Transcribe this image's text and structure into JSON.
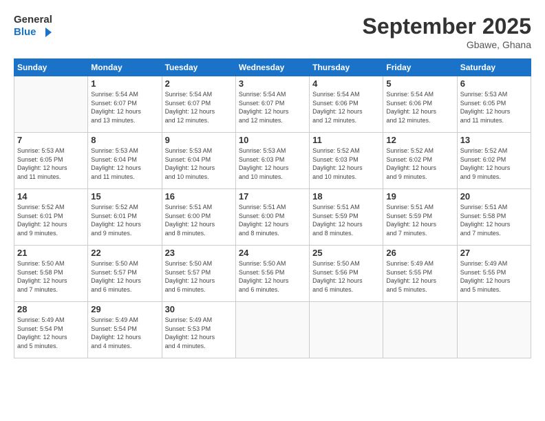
{
  "header": {
    "logo_general": "General",
    "logo_blue": "Blue",
    "month_title": "September 2025",
    "location": "Gbawe, Ghana"
  },
  "days_of_week": [
    "Sunday",
    "Monday",
    "Tuesday",
    "Wednesday",
    "Thursday",
    "Friday",
    "Saturday"
  ],
  "weeks": [
    [
      {
        "day": "",
        "sunrise": "",
        "sunset": "",
        "daylight": ""
      },
      {
        "day": "1",
        "sunrise": "Sunrise: 5:54 AM",
        "sunset": "Sunset: 6:07 PM",
        "daylight": "Daylight: 12 hours and 13 minutes."
      },
      {
        "day": "2",
        "sunrise": "Sunrise: 5:54 AM",
        "sunset": "Sunset: 6:07 PM",
        "daylight": "Daylight: 12 hours and 12 minutes."
      },
      {
        "day": "3",
        "sunrise": "Sunrise: 5:54 AM",
        "sunset": "Sunset: 6:07 PM",
        "daylight": "Daylight: 12 hours and 12 minutes."
      },
      {
        "day": "4",
        "sunrise": "Sunrise: 5:54 AM",
        "sunset": "Sunset: 6:06 PM",
        "daylight": "Daylight: 12 hours and 12 minutes."
      },
      {
        "day": "5",
        "sunrise": "Sunrise: 5:54 AM",
        "sunset": "Sunset: 6:06 PM",
        "daylight": "Daylight: 12 hours and 12 minutes."
      },
      {
        "day": "6",
        "sunrise": "Sunrise: 5:53 AM",
        "sunset": "Sunset: 6:05 PM",
        "daylight": "Daylight: 12 hours and 11 minutes."
      }
    ],
    [
      {
        "day": "7",
        "sunrise": "Sunrise: 5:53 AM",
        "sunset": "Sunset: 6:05 PM",
        "daylight": "Daylight: 12 hours and 11 minutes."
      },
      {
        "day": "8",
        "sunrise": "Sunrise: 5:53 AM",
        "sunset": "Sunset: 6:04 PM",
        "daylight": "Daylight: 12 hours and 11 minutes."
      },
      {
        "day": "9",
        "sunrise": "Sunrise: 5:53 AM",
        "sunset": "Sunset: 6:04 PM",
        "daylight": "Daylight: 12 hours and 10 minutes."
      },
      {
        "day": "10",
        "sunrise": "Sunrise: 5:53 AM",
        "sunset": "Sunset: 6:03 PM",
        "daylight": "Daylight: 12 hours and 10 minutes."
      },
      {
        "day": "11",
        "sunrise": "Sunrise: 5:52 AM",
        "sunset": "Sunset: 6:03 PM",
        "daylight": "Daylight: 12 hours and 10 minutes."
      },
      {
        "day": "12",
        "sunrise": "Sunrise: 5:52 AM",
        "sunset": "Sunset: 6:02 PM",
        "daylight": "Daylight: 12 hours and 9 minutes."
      },
      {
        "day": "13",
        "sunrise": "Sunrise: 5:52 AM",
        "sunset": "Sunset: 6:02 PM",
        "daylight": "Daylight: 12 hours and 9 minutes."
      }
    ],
    [
      {
        "day": "14",
        "sunrise": "Sunrise: 5:52 AM",
        "sunset": "Sunset: 6:01 PM",
        "daylight": "Daylight: 12 hours and 9 minutes."
      },
      {
        "day": "15",
        "sunrise": "Sunrise: 5:52 AM",
        "sunset": "Sunset: 6:01 PM",
        "daylight": "Daylight: 12 hours and 9 minutes."
      },
      {
        "day": "16",
        "sunrise": "Sunrise: 5:51 AM",
        "sunset": "Sunset: 6:00 PM",
        "daylight": "Daylight: 12 hours and 8 minutes."
      },
      {
        "day": "17",
        "sunrise": "Sunrise: 5:51 AM",
        "sunset": "Sunset: 6:00 PM",
        "daylight": "Daylight: 12 hours and 8 minutes."
      },
      {
        "day": "18",
        "sunrise": "Sunrise: 5:51 AM",
        "sunset": "Sunset: 5:59 PM",
        "daylight": "Daylight: 12 hours and 8 minutes."
      },
      {
        "day": "19",
        "sunrise": "Sunrise: 5:51 AM",
        "sunset": "Sunset: 5:59 PM",
        "daylight": "Daylight: 12 hours and 7 minutes."
      },
      {
        "day": "20",
        "sunrise": "Sunrise: 5:51 AM",
        "sunset": "Sunset: 5:58 PM",
        "daylight": "Daylight: 12 hours and 7 minutes."
      }
    ],
    [
      {
        "day": "21",
        "sunrise": "Sunrise: 5:50 AM",
        "sunset": "Sunset: 5:58 PM",
        "daylight": "Daylight: 12 hours and 7 minutes."
      },
      {
        "day": "22",
        "sunrise": "Sunrise: 5:50 AM",
        "sunset": "Sunset: 5:57 PM",
        "daylight": "Daylight: 12 hours and 6 minutes."
      },
      {
        "day": "23",
        "sunrise": "Sunrise: 5:50 AM",
        "sunset": "Sunset: 5:57 PM",
        "daylight": "Daylight: 12 hours and 6 minutes."
      },
      {
        "day": "24",
        "sunrise": "Sunrise: 5:50 AM",
        "sunset": "Sunset: 5:56 PM",
        "daylight": "Daylight: 12 hours and 6 minutes."
      },
      {
        "day": "25",
        "sunrise": "Sunrise: 5:50 AM",
        "sunset": "Sunset: 5:56 PM",
        "daylight": "Daylight: 12 hours and 6 minutes."
      },
      {
        "day": "26",
        "sunrise": "Sunrise: 5:49 AM",
        "sunset": "Sunset: 5:55 PM",
        "daylight": "Daylight: 12 hours and 5 minutes."
      },
      {
        "day": "27",
        "sunrise": "Sunrise: 5:49 AM",
        "sunset": "Sunset: 5:55 PM",
        "daylight": "Daylight: 12 hours and 5 minutes."
      }
    ],
    [
      {
        "day": "28",
        "sunrise": "Sunrise: 5:49 AM",
        "sunset": "Sunset: 5:54 PM",
        "daylight": "Daylight: 12 hours and 5 minutes."
      },
      {
        "day": "29",
        "sunrise": "Sunrise: 5:49 AM",
        "sunset": "Sunset: 5:54 PM",
        "daylight": "Daylight: 12 hours and 4 minutes."
      },
      {
        "day": "30",
        "sunrise": "Sunrise: 5:49 AM",
        "sunset": "Sunset: 5:53 PM",
        "daylight": "Daylight: 12 hours and 4 minutes."
      },
      {
        "day": "",
        "sunrise": "",
        "sunset": "",
        "daylight": ""
      },
      {
        "day": "",
        "sunrise": "",
        "sunset": "",
        "daylight": ""
      },
      {
        "day": "",
        "sunrise": "",
        "sunset": "",
        "daylight": ""
      },
      {
        "day": "",
        "sunrise": "",
        "sunset": "",
        "daylight": ""
      }
    ]
  ]
}
